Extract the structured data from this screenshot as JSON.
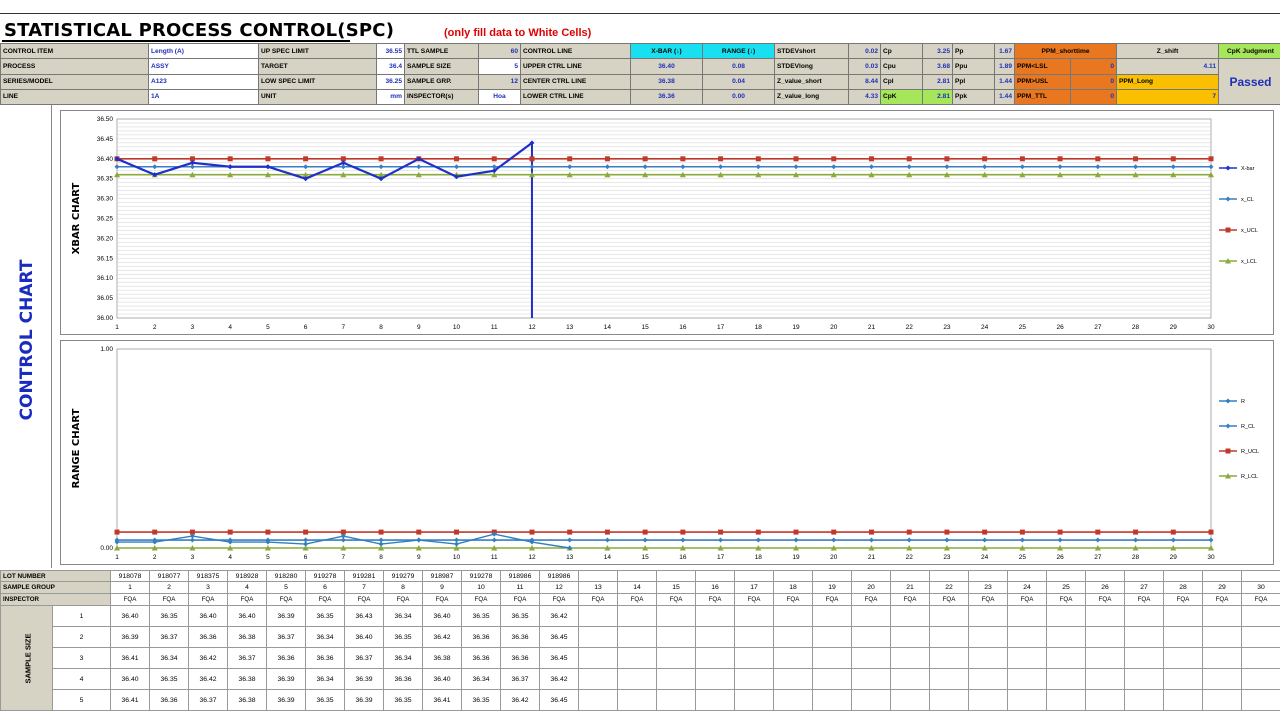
{
  "header": {
    "title": "STATISTICAL PROCESS CONTROL(SPC)",
    "note": "(only fill data to White Cells)",
    "rows": [
      {
        "c1": "CONTROL ITEM",
        "c2": "Length  (A)",
        "c3": "UP SPEC LIMIT",
        "c4": "36.55",
        "c5": "TTL SAMPLE",
        "c6": "60",
        "c7": "CONTROL LINE",
        "c8": "X-BAR (↓)",
        "c9": "RANGE (↓)",
        "c10": "STDEVshort",
        "c11": "0.02",
        "c12": "Cp",
        "c13": "3.25",
        "c14": "Pp",
        "c15": "1.67",
        "c16": "PPM_shorttime",
        "c17": "Z_shift",
        "c18": "CpK Judgment"
      },
      {
        "c1": "PROCESS",
        "c2": "ASSY",
        "c3": "TARGET",
        "c4": "36.4",
        "c5": "SAMPLE SIZE",
        "c6": "5",
        "c7": "UPPER CTRL LINE",
        "c8": "36.40",
        "c9": "0.08",
        "c10": "STDEVlong",
        "c11": "0.03",
        "c12": "Cpu",
        "c13": "3.68",
        "c14": "Ppu",
        "c15": "1.89",
        "c16": "PPM<LSL",
        "c16v": "0",
        "c17": "4.11",
        "c18": "Passed"
      },
      {
        "c1": "SERIES/MODEL",
        "c2": "A123",
        "c3": "LOW SPEC LIMIT",
        "c4": "36.25",
        "c5": "SAMPLE GRP.",
        "c6": "12",
        "c7": "CENTER CTRL LINE",
        "c8": "36.38",
        "c9": "0.04",
        "c10": "Z_value_short",
        "c11": "8.44",
        "c12": "Cpl",
        "c13": "2.81",
        "c14": "Ppl",
        "c15": "1.44",
        "c16": "PPM>USL",
        "c16v": "0",
        "c17": "PPM_Long"
      },
      {
        "c1": "LINE",
        "c2": "1A",
        "c3": "UNIT",
        "c4": "mm",
        "c5": "INSPECTOR(s)",
        "c6": "Hoa",
        "c7": "LOWER CTRL LINE",
        "c8": "36.36",
        "c9": "0.00",
        "c10": "Z_value_long",
        "c11": "4.33",
        "c12": "CpK",
        "c13": "2.81",
        "c14": "Ppk",
        "c15": "1.44",
        "c16": "PPM_TTL",
        "c16v": "0",
        "c17": "7"
      }
    ]
  },
  "side_label": "CONTROL CHART",
  "chart_data": [
    {
      "type": "line",
      "title": "",
      "ylabel": "XBAR CHART",
      "xlabel": "",
      "ylim": [
        36.0,
        36.5
      ],
      "yticks": [
        "36.50",
        "36.45",
        "36.40",
        "36.35",
        "36.30",
        "36.25",
        "36.20",
        "36.15",
        "36.10",
        "36.05",
        "36.00"
      ],
      "x": [
        1,
        2,
        3,
        4,
        5,
        6,
        7,
        8,
        9,
        10,
        11,
        12,
        13,
        14,
        15,
        16,
        17,
        18,
        19,
        20,
        21,
        22,
        23,
        24,
        25,
        26,
        27,
        28,
        29,
        30
      ],
      "legend_position": "right",
      "grid": true,
      "series": [
        {
          "name": "X-bar",
          "color": "#1f2fc8",
          "values": [
            36.4,
            36.36,
            36.39,
            36.38,
            36.38,
            36.35,
            36.39,
            36.35,
            36.4,
            36.355,
            36.37,
            36.44
          ]
        },
        {
          "name": "x_CL",
          "color": "#3a7fc0",
          "values": [
            36.38,
            36.38,
            36.38,
            36.38,
            36.38,
            36.38,
            36.38,
            36.38,
            36.38,
            36.38,
            36.38,
            36.38,
            36.38,
            36.38,
            36.38,
            36.38,
            36.38,
            36.38,
            36.38,
            36.38,
            36.38,
            36.38,
            36.38,
            36.38,
            36.38,
            36.38,
            36.38,
            36.38,
            36.38,
            36.38
          ]
        },
        {
          "name": "x_UCL",
          "color": "#c0392b",
          "values": [
            36.4,
            36.4,
            36.4,
            36.4,
            36.4,
            36.4,
            36.4,
            36.4,
            36.4,
            36.4,
            36.4,
            36.4,
            36.4,
            36.4,
            36.4,
            36.4,
            36.4,
            36.4,
            36.4,
            36.4,
            36.4,
            36.4,
            36.4,
            36.4,
            36.4,
            36.4,
            36.4,
            36.4,
            36.4,
            36.4
          ]
        },
        {
          "name": "x_LCL",
          "color": "#8aaa3c",
          "values": [
            36.36,
            36.36,
            36.36,
            36.36,
            36.36,
            36.36,
            36.36,
            36.36,
            36.36,
            36.36,
            36.36,
            36.36,
            36.36,
            36.36,
            36.36,
            36.36,
            36.36,
            36.36,
            36.36,
            36.36,
            36.36,
            36.36,
            36.36,
            36.36,
            36.36,
            36.36,
            36.36,
            36.36,
            36.36,
            36.36
          ]
        }
      ],
      "drop_line_at": 12
    },
    {
      "type": "line",
      "title": "",
      "ylabel": "RANGE CHART",
      "xlabel": "",
      "ylim": [
        0.0,
        1.0
      ],
      "yticks": [
        "1.00",
        "0.00"
      ],
      "x": [
        1,
        2,
        3,
        4,
        5,
        6,
        7,
        8,
        9,
        10,
        11,
        12,
        13,
        14,
        15,
        16,
        17,
        18,
        19,
        20,
        21,
        22,
        23,
        24,
        25,
        26,
        27,
        28,
        29,
        30
      ],
      "legend_position": "right",
      "grid": false,
      "series": [
        {
          "name": "R",
          "color": "#2f7fc0",
          "values": [
            0.03,
            0.03,
            0.06,
            0.03,
            0.03,
            0.02,
            0.06,
            0.02,
            0.04,
            0.02,
            0.07,
            0.03,
            0.0
          ]
        },
        {
          "name": "R_CL",
          "color": "#3a7fc0",
          "values": [
            0.04,
            0.04,
            0.04,
            0.04,
            0.04,
            0.04,
            0.04,
            0.04,
            0.04,
            0.04,
            0.04,
            0.04,
            0.04,
            0.04,
            0.04,
            0.04,
            0.04,
            0.04,
            0.04,
            0.04,
            0.04,
            0.04,
            0.04,
            0.04,
            0.04,
            0.04,
            0.04,
            0.04,
            0.04,
            0.04
          ]
        },
        {
          "name": "R_UCL",
          "color": "#c0392b",
          "values": [
            0.08,
            0.08,
            0.08,
            0.08,
            0.08,
            0.08,
            0.08,
            0.08,
            0.08,
            0.08,
            0.08,
            0.08,
            0.08,
            0.08,
            0.08,
            0.08,
            0.08,
            0.08,
            0.08,
            0.08,
            0.08,
            0.08,
            0.08,
            0.08,
            0.08,
            0.08,
            0.08,
            0.08,
            0.08,
            0.08
          ]
        },
        {
          "name": "R_LCL",
          "color": "#8aaa3c",
          "values": [
            0.0,
            0.0,
            0.0,
            0.0,
            0.0,
            0.0,
            0.0,
            0.0,
            0.0,
            0.0,
            0.0,
            0.0,
            0.0,
            0.0,
            0.0,
            0.0,
            0.0,
            0.0,
            0.0,
            0.0,
            0.0,
            0.0,
            0.0,
            0.0,
            0.0,
            0.0,
            0.0,
            0.0,
            0.0,
            0.0
          ]
        }
      ]
    }
  ],
  "data_table": {
    "lot_label": "LOT NUMBER",
    "group_label": "SAMPLE GROUP",
    "inspector_label": "INSPECTOR",
    "sample_size_label": "SAMPLE SIZE",
    "lots": [
      "918078",
      "918077",
      "918375",
      "918928",
      "918280",
      "919278",
      "919281",
      "919279",
      "918987",
      "919278",
      "918986",
      "918986",
      "",
      "",
      "",
      "",
      "",
      "",
      "",
      "",
      "",
      "",
      "",
      "",
      "",
      "",
      "",
      "",
      "",
      ""
    ],
    "groups": [
      "1",
      "2",
      "3",
      "4",
      "5",
      "6",
      "7",
      "8",
      "9",
      "10",
      "11",
      "12",
      "13",
      "14",
      "15",
      "16",
      "17",
      "18",
      "19",
      "20",
      "21",
      "22",
      "23",
      "24",
      "25",
      "26",
      "27",
      "28",
      "29",
      "30"
    ],
    "inspectors": [
      "FQA",
      "FQA",
      "FQA",
      "FQA",
      "FQA",
      "FQA",
      "FQA",
      "FQA",
      "FQA",
      "FQA",
      "FQA",
      "FQA",
      "FQA",
      "FQA",
      "FQA",
      "FQA",
      "FQA",
      "FQA",
      "FQA",
      "FQA",
      "FQA",
      "FQA",
      "FQA",
      "FQA",
      "FQA",
      "FQA",
      "FQA",
      "FQA",
      "FQA",
      "FQA"
    ],
    "sample_rows": [
      {
        "n": "1",
        "values": [
          "36.40",
          "36.35",
          "36.40",
          "36.40",
          "36.39",
          "36.35",
          "36.43",
          "36.34",
          "36.40",
          "36.35",
          "36.35",
          "36.42"
        ]
      },
      {
        "n": "2",
        "values": [
          "36.39",
          "36.37",
          "36.36",
          "36.38",
          "36.37",
          "36.34",
          "36.40",
          "36.35",
          "36.42",
          "36.36",
          "36.36",
          "36.45"
        ]
      },
      {
        "n": "3",
        "values": [
          "36.41",
          "36.34",
          "36.42",
          "36.37",
          "36.36",
          "36.36",
          "36.37",
          "36.34",
          "36.38",
          "36.36",
          "36.36",
          "36.45"
        ]
      },
      {
        "n": "4",
        "values": [
          "36.40",
          "36.35",
          "36.42",
          "36.38",
          "36.39",
          "36.34",
          "36.39",
          "36.36",
          "36.40",
          "36.34",
          "36.37",
          "36.42"
        ]
      },
      {
        "n": "5",
        "values": [
          "36.41",
          "36.36",
          "36.37",
          "36.38",
          "36.39",
          "36.35",
          "36.39",
          "36.35",
          "36.41",
          "36.35",
          "36.42",
          "36.45"
        ]
      }
    ]
  }
}
